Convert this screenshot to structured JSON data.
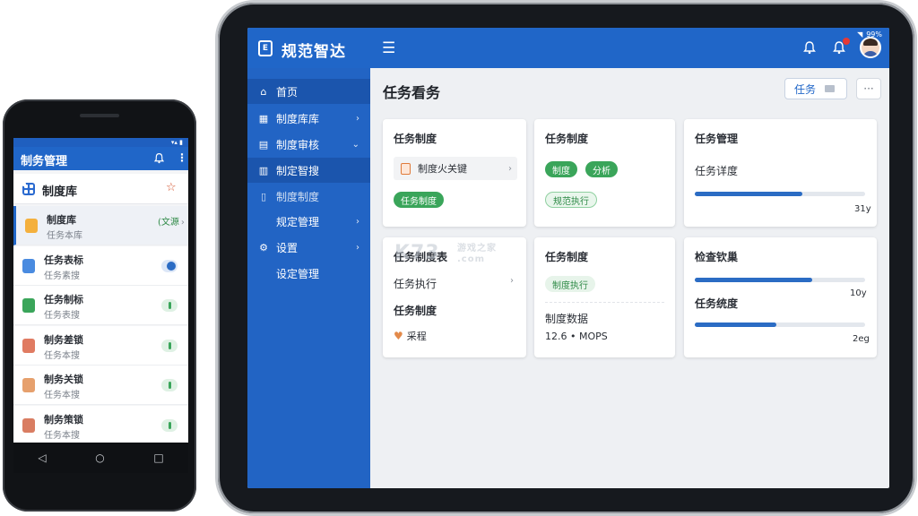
{
  "tablet": {
    "status_text": "99%",
    "app_title": "规范智达",
    "logo_glyph": "E",
    "menu_glyph": "☰",
    "sidebar": [
      {
        "label": "首页",
        "icon": "home-icon",
        "glyph": "⌂",
        "active": true
      },
      {
        "label": "制度库库",
        "icon": "grid-icon",
        "glyph": "▦",
        "chevron": "›"
      },
      {
        "label": "制度审核",
        "icon": "document-icon",
        "glyph": "▤",
        "chevron": "⌄"
      },
      {
        "label": "制定智搜",
        "icon": "chart-icon",
        "glyph": "▥"
      },
      {
        "label": "制度制度",
        "icon": "file-icon",
        "glyph": "▯"
      },
      {
        "label": "规定管理",
        "icon": "none",
        "glyph": "",
        "chevron": "›"
      },
      {
        "label": "设置",
        "icon": "gear-icon",
        "glyph": "⚙",
        "chevron": "›"
      },
      {
        "label": "设定管理",
        "icon": "none",
        "glyph": ""
      }
    ],
    "page_title": "任务看务",
    "task_button_label": "任务",
    "more_button_label": "···",
    "cards": {
      "c1": {
        "title": "任务制度",
        "doc_label": "制度火关键",
        "chevron": "›",
        "pill": "任务制度"
      },
      "c2": {
        "title": "任务制度",
        "pill_a": "制度",
        "pill_b": "分析",
        "pill_c": "规范执行"
      },
      "c3": {
        "title": "任务管理",
        "line": "任务详度",
        "progress": 0.63,
        "value": "31y"
      },
      "c4": {
        "title": "任务制度表",
        "line1": "任务执行",
        "chevron": "›",
        "line2": "任务制度",
        "note": "采程"
      },
      "c5": {
        "title": "任务制度",
        "pill": "制度执行",
        "line1": "制度数据",
        "line2": "12.6 • MOPS"
      },
      "c6": {
        "title": "检查钦巢",
        "progress1": 0.69,
        "value1": "10y",
        "line": "任务统度",
        "progress2": 0.48,
        "value2": "2eg"
      }
    },
    "watermark": {
      "main": "K73",
      "sub": "游戏之家",
      "domain": ".com"
    }
  },
  "phone": {
    "status_text": "▾▴ ▮",
    "app_title": "制务管理",
    "more_glyph": "⋮",
    "section_title": "制度库",
    "star_glyph": "☆",
    "rows": [
      {
        "title": "制度库",
        "subtitle": "任务本库",
        "icon_color": "#f4b03d",
        "tag": "(文源",
        "tag_chev": "›",
        "selected": true
      },
      {
        "title": "任务表标",
        "subtitle": "任务素搜",
        "icon_color": "#4a8be0",
        "toggle": "blue"
      },
      {
        "title": "任务制标",
        "subtitle": "任务表搜",
        "icon_color": "#3aa55a",
        "toggle": "green"
      },
      {
        "title": "制务差锁",
        "subtitle": "任务本搜",
        "icon_color": "#e07b62",
        "toggle": "green"
      },
      {
        "title": "制务关锁",
        "subtitle": "任务本搜",
        "icon_color": "#e6a06d",
        "toggle": "green"
      },
      {
        "title": "制务策锁",
        "subtitle": "任务本搜",
        "icon_color": "#d97d62",
        "toggle": "green"
      }
    ],
    "nav": {
      "back": "◁",
      "home": "○",
      "recent": "□"
    }
  },
  "colors": {
    "primary": "#2066c8",
    "sidebar": "#2264c4",
    "green": "#3aa55a",
    "bg": "#eef0f3"
  }
}
